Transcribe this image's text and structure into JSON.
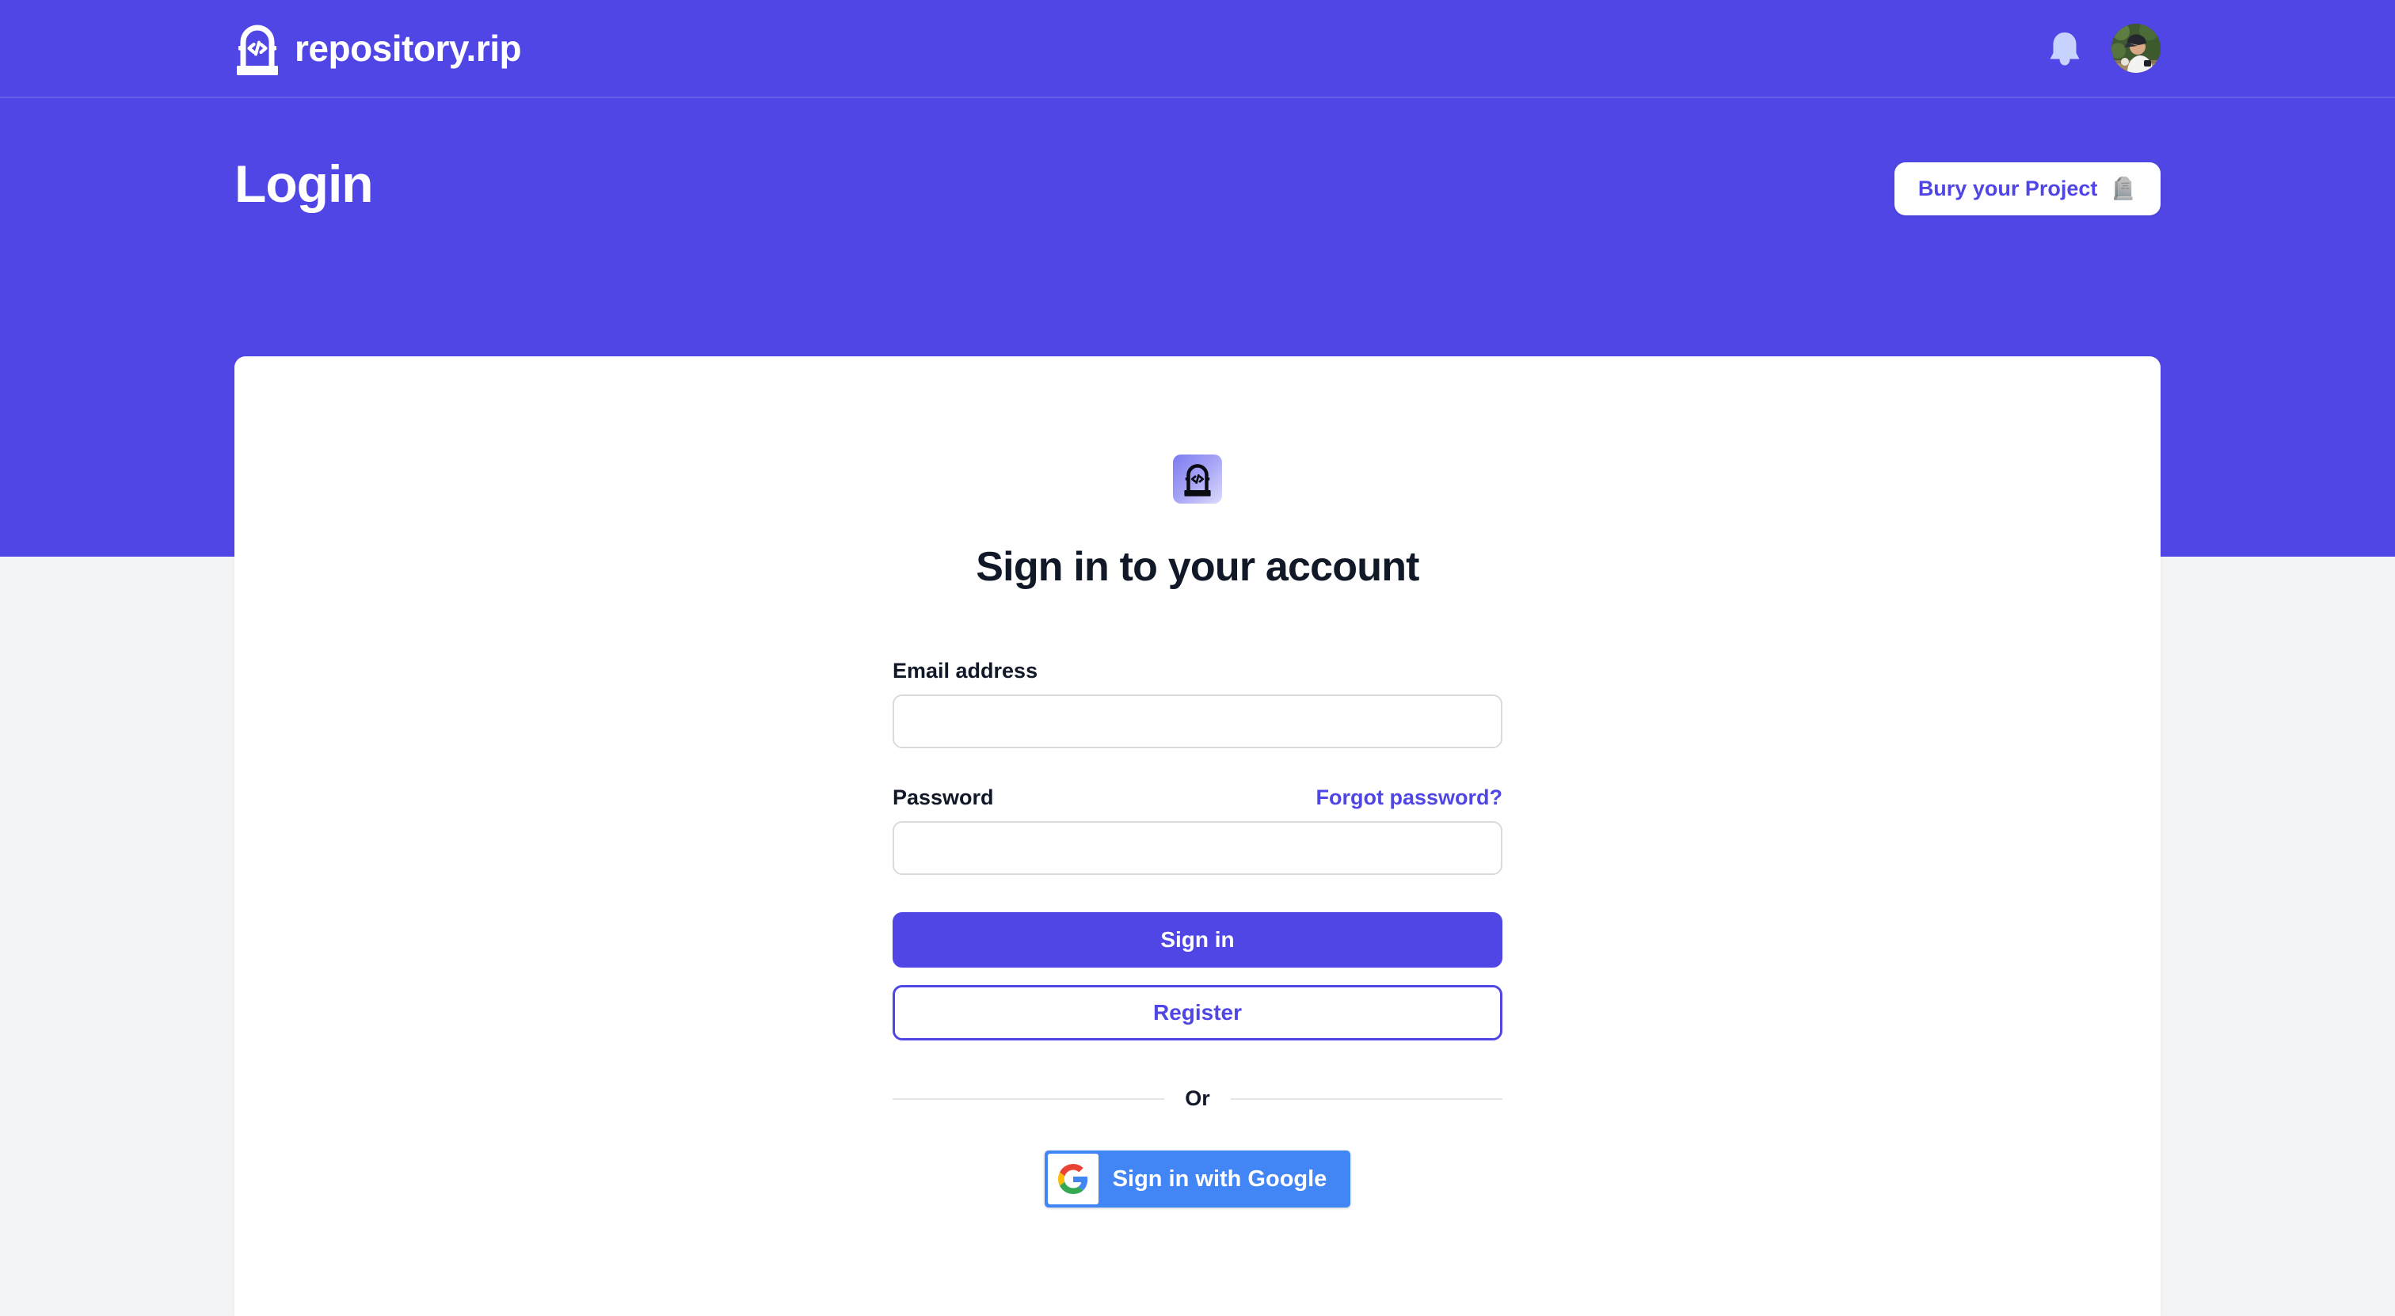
{
  "header": {
    "brand_name": "repository.rip",
    "brand_logo_icon": "tombstone-code-icon",
    "notifications_icon": "bell-icon",
    "avatar_icon": "user-avatar-photo"
  },
  "page": {
    "title": "Login",
    "cta": {
      "label": "Bury your Project",
      "emoji": "🪦"
    }
  },
  "card": {
    "logo_icon": "tombstone-code-icon",
    "heading": "Sign in to your account",
    "fields": {
      "email": {
        "label": "Email address",
        "value": "",
        "placeholder": ""
      },
      "password": {
        "label": "Password",
        "value": "",
        "placeholder": "",
        "forgot_label": "Forgot password?"
      }
    },
    "actions": {
      "sign_in": "Sign in",
      "register": "Register"
    },
    "divider_text": "Or",
    "google": {
      "label": "Sign in with Google",
      "icon": "google-g-icon"
    }
  },
  "colors": {
    "brand_purple": "#4f46e5",
    "page_background": "#f1f3f5",
    "card_background": "#ffffff",
    "google_blue": "#4285f4",
    "text_dark": "#111827",
    "input_border": "#d8dadd"
  }
}
